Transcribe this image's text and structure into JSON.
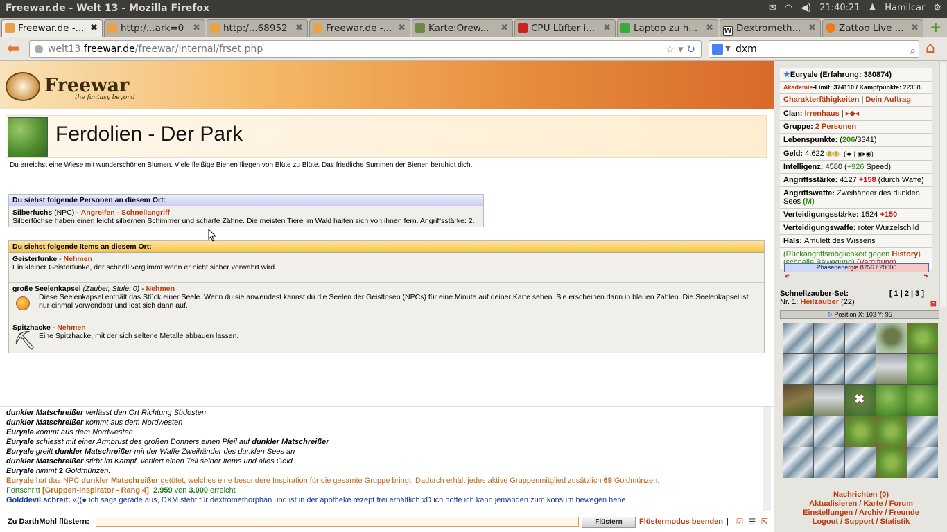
{
  "os": {
    "window_title": "Freewar.de - Welt 13 - Mozilla Firefox",
    "clock": "21:40:21",
    "user": "Hamilcar"
  },
  "tabs": [
    {
      "label": "Freewar.de -...",
      "color": "#e9a24a"
    },
    {
      "label": "http:/...ark=0",
      "color": "#e9a24a"
    },
    {
      "label": "http:/...68952",
      "color": "#e9a24a"
    },
    {
      "label": "Freewar.de -...",
      "color": "#e9a24a"
    },
    {
      "label": "Karte:Orew...",
      "color": "#6b8a4a"
    },
    {
      "label": "CPU Lüfter i...",
      "color": "#cc2222"
    },
    {
      "label": "Laptop zu h...",
      "color": "#3aaa3a"
    },
    {
      "label": "Dextrometh...",
      "color": "#ffffff"
    },
    {
      "label": "Zattoo Live ...",
      "color": "#ee7a1a"
    }
  ],
  "nav": {
    "url_prefix": "welt13.",
    "url_domain": "freewar.de",
    "url_path": "/freewar/internal/frset.php",
    "search": "dxm"
  },
  "game": {
    "logo_title": "Freewar",
    "logo_sub": "the fantasy beyond",
    "place_title": "Ferdolien - Der Park",
    "place_desc": "Du erreichst eine Wiese mit wunderschönen Blumen. Viele fleißige Bienen fliegen von Blüte zu Blüte. Das friedliche Summen der Bienen beruhigt dich.",
    "persons_header": "Du siehst folgende Personen an diesem Ort:",
    "person": {
      "name": "Silberfuchs",
      "type": " (NPC) - ",
      "attack": "Angreifen",
      "sep": " - ",
      "fast": "Schnellangriff",
      "desc": "Silberfüchse haben einen leicht silbernen Schimmer und scharfe Zähne. Die meisten Tiere im Wald halten sich von ihnen fern. Angriffsstärke: 2."
    },
    "items_header": "Du siehst folgende Items an diesem Ort:",
    "items": [
      {
        "name": "Geisterfunke",
        "extra": "",
        "take": "Nehmen",
        "desc": "Ein kleiner Geisterfunke, der schnell verglimmt wenn er nicht sicher verwahrt wird."
      },
      {
        "name": "große Seelenkapsel",
        "extra": "(Zauber, Stufe: 0)",
        "take": "Nehmen",
        "desc": "Diese Seelenkapsel enthält das Stück einer Seele. Wenn du sie anwendest kannst du die Seelen der Geistlosen (NPCs) für eine Minute auf deiner Karte sehen. Sie erscheinen dann in blauen Zahlen. Die Seelenkapsel ist nur einmal verwendbar und löst sich dann auf."
      },
      {
        "name": "Spitzhacke",
        "extra": "",
        "take": "Nehmen",
        "desc": "Eine Spitzhacke, mit der sich seltene Metalle abbauen lassen."
      }
    ]
  },
  "chat": {
    "lines": [
      {
        "a": "dunkler Matschreißer",
        "b": " verlässt den Ort Richtung Südosten"
      },
      {
        "a": "dunkler Matschreißer",
        "b": " kommt aus dem Nordwesten"
      },
      {
        "a": "Euryale",
        "b": " kommt aus dem Nordwesten"
      },
      {
        "a": "Euryale",
        "b": " schiesst mit einer Armbrust des großen Donners einen Pfeil auf ",
        "c": "dunkler Matschreißer"
      },
      {
        "a": "Euryale",
        "b": " greift ",
        "c": "dunkler Matschreißer",
        "d": " mit der Waffe Zweihänder des dunklen Sees an"
      },
      {
        "a": "dunkler Matschreißer",
        "b": " stirbt im Kampf, verliert einen Teil seiner Items und alles Gold"
      },
      {
        "a": "Euryale",
        "b": " nimmt ",
        "c": "2",
        "d": " Goldmünzen."
      }
    ],
    "inspiration": {
      "a": "Euryale",
      "b": " hat das NPC ",
      "c": "dunkler Matschreißer",
      "d": " getötet, welches eine besondere Inspiration für die gesamte Gruppe bringt. Dadurch erhält jedes aktive Gruppenmitglied zusätzlich ",
      "e": "69",
      "f": " Goldmünzen."
    },
    "progress": {
      "a": "Fortschritt ",
      "b": "[Gruppen-Inspirator - Rang 4]",
      "c": ": ",
      "d": "2.959",
      "e": " von ",
      "f": "3.000",
      "g": " erreicht"
    },
    "golddevil": {
      "name": "Golddevil schreit:",
      "text": " ich sags gerade aus, DXM steht für dextromethorphan und ist in der apotheke rezept frei erhältlich xD ich hoffe ich kann jemanden zum konsum bewegen hehe"
    }
  },
  "whisper": {
    "label": "Zu DarthMohl flüstern:",
    "button": "Flüstern",
    "end": "Flüstermodus beenden",
    "sep": "|"
  },
  "side": {
    "char": "Euryale (Erfahrung: 380874)",
    "akademie": "Akademie",
    "limit": "-Limit: 374110 / ",
    "kampf_label": "Kampfpunkte: ",
    "kampf": "22358",
    "faehig": "Charakterfähigkeiten",
    "auftrag": "Dein Auftrag",
    "clan_label": "Clan: ",
    "clan": "Irrenhaus",
    "gruppe_label": "Gruppe: ",
    "gruppe": "2 Personen",
    "lp_label": "Lebenspunkte: ",
    "lp_open": "(",
    "lp_cur": "206",
    "lp_max": "/3341)",
    "geld_label": "Geld: ",
    "geld": "4.622",
    "int_label": "Intelligenz: ",
    "int": "4580",
    "int_bonus_open": " (",
    "int_bonus": "+926",
    "int_bonus_close": " Speed)",
    "as_label": "Angriffsstärke: ",
    "as": "4127 ",
    "as_bonus": "+158",
    "as_note": " (durch Waffe)",
    "aw_label": "Angriffswaffe: ",
    "aw": "Zweihänder des dunklen Sees ",
    "aw_m": "(M)",
    "vs_label": "Verteidigungsstärke: ",
    "vs": "1524 ",
    "vs_bonus": "+150",
    "vw_label": "Verteidigungswaffe: ",
    "vw": "roter Wurzelschild",
    "hals_label": "Hals: ",
    "hals": "Amulett des Wissens",
    "rueck": "(Rückangriffsmöglichkeit gegen ",
    "history": "History",
    "rueck_close": ")",
    "schnelle": "(schnelle Bewegung) ",
    "vergiftung": "(Vergiftung)",
    "phase": "Phasenenergie 8756 / 20000",
    "phase_frac": 0.4378,
    "schnell_label": "Schnellzauber-Set:",
    "set": "[ 1 | 2 | 3 ]",
    "nr": "Nr. 1: ",
    "heil": "Heilzauber",
    "heil_n": " (22)",
    "position": "Position X: 103 Y: 95",
    "nachrichten": "Nachrichten (0)",
    "links1": "Aktualisieren / Karte / Forum",
    "links2": "Einstellungen / Archiv / Freunde",
    "links3": "Logout / Support / Statistik"
  }
}
